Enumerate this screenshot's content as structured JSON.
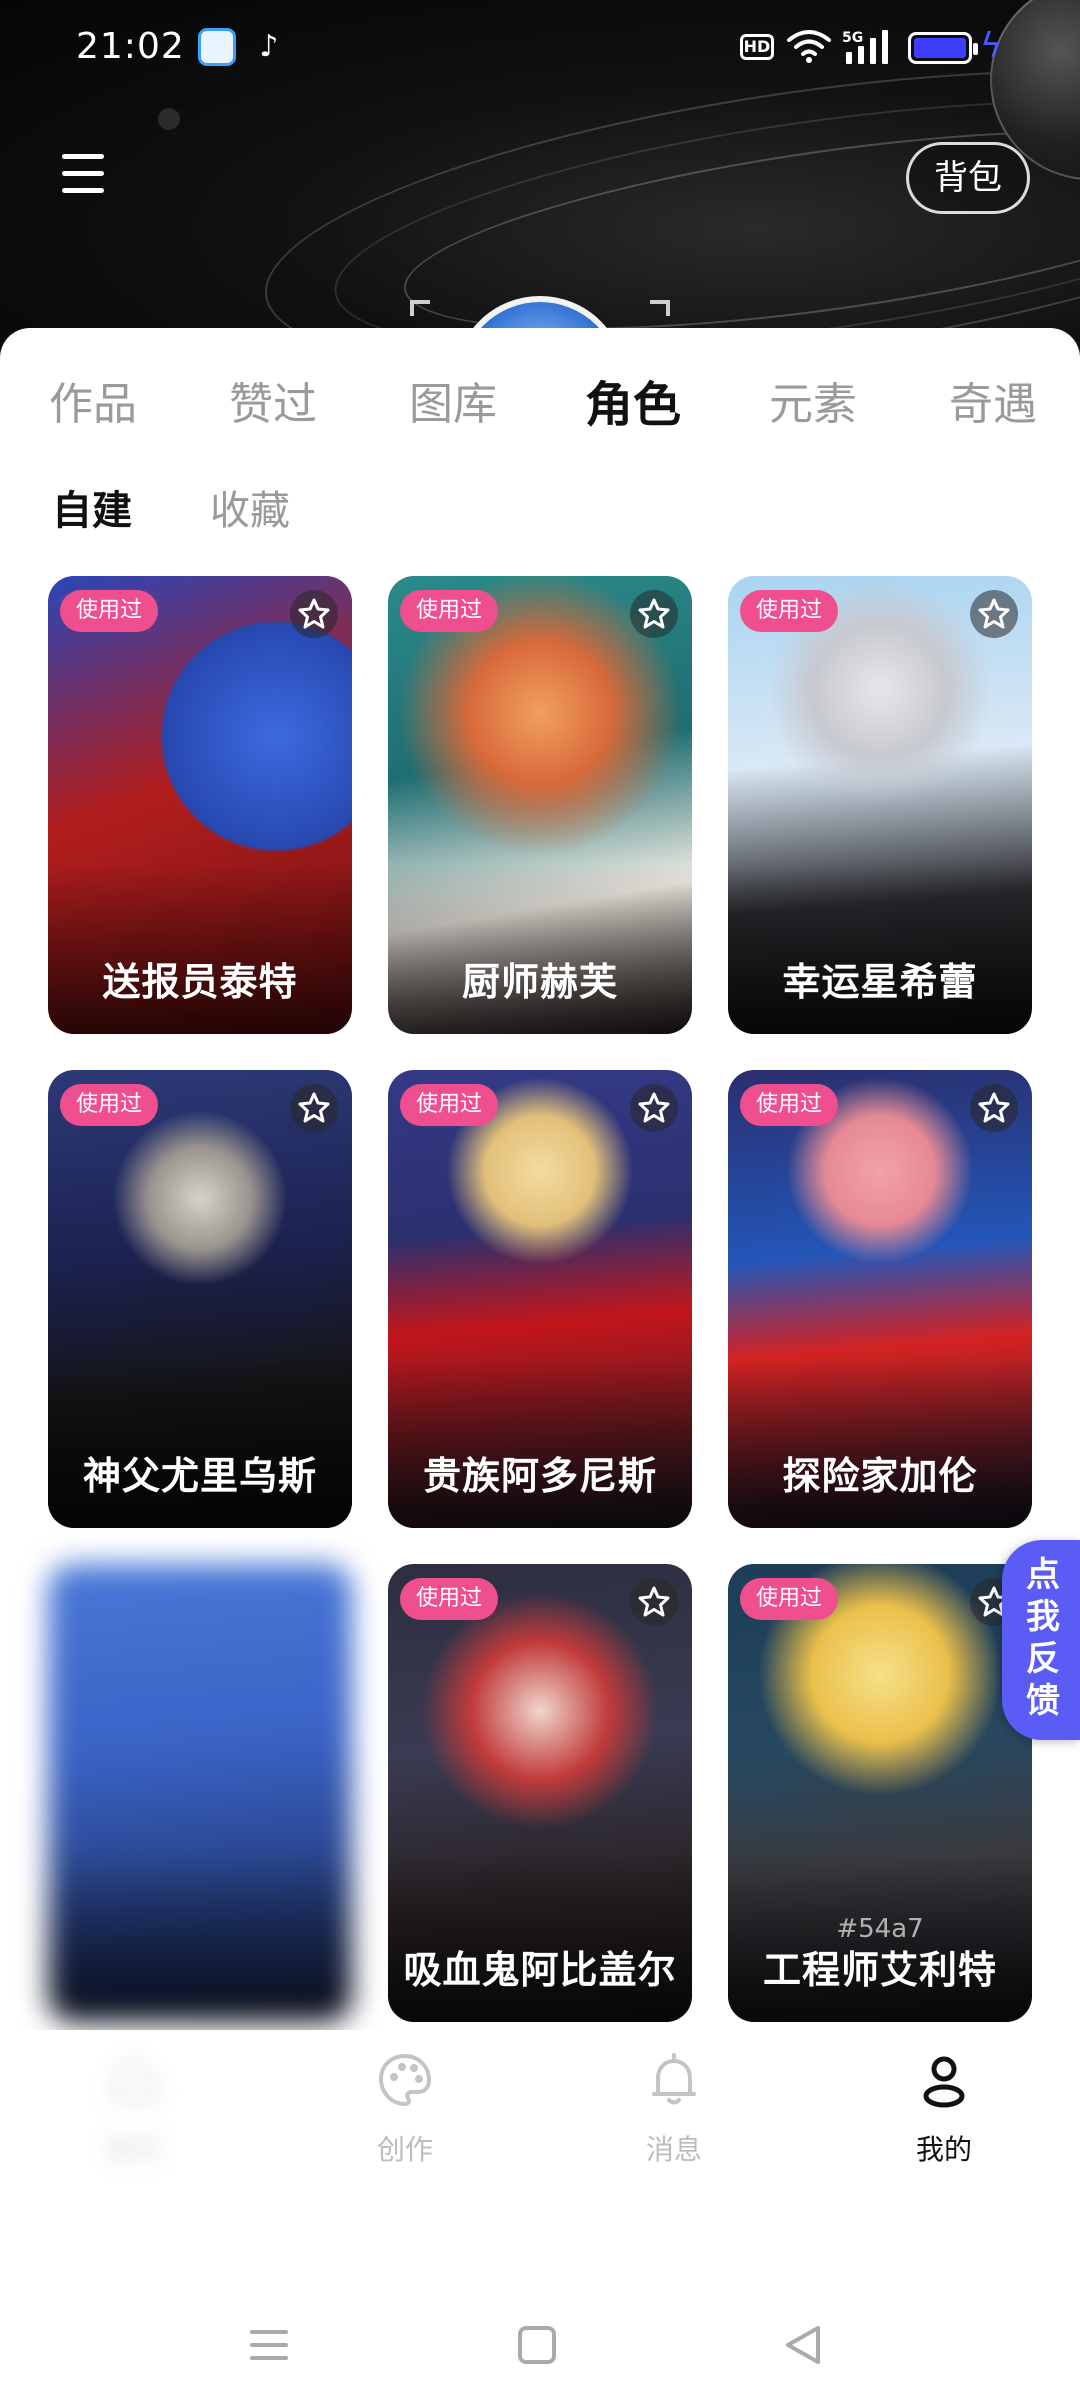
{
  "status_bar": {
    "time": "21:02",
    "hd_label": "HD",
    "network": "5G",
    "battery_color": "#3d3dff"
  },
  "header": {
    "bag_label": "背包"
  },
  "tabs": [
    {
      "label": "作品",
      "active": false
    },
    {
      "label": "赞过",
      "active": false
    },
    {
      "label": "图库",
      "active": false
    },
    {
      "label": "角色",
      "active": true
    },
    {
      "label": "元素",
      "active": false
    },
    {
      "label": "奇遇",
      "active": false
    }
  ],
  "subtabs": [
    {
      "label": "自建",
      "active": true
    },
    {
      "label": "收藏",
      "active": false
    }
  ],
  "cards": [
    {
      "name": "送报员泰特",
      "badge": "使用过",
      "tag": ""
    },
    {
      "name": "厨师赫芙",
      "badge": "使用过",
      "tag": ""
    },
    {
      "name": "幸运星希蕾",
      "badge": "使用过",
      "tag": ""
    },
    {
      "name": "神父尤里乌斯",
      "badge": "使用过",
      "tag": ""
    },
    {
      "name": "贵族阿多尼斯",
      "badge": "使用过",
      "tag": ""
    },
    {
      "name": "探险家加伦",
      "badge": "使用过",
      "tag": ""
    },
    {
      "name": "",
      "badge": "",
      "tag": ""
    },
    {
      "name": "吸血鬼阿比盖尔",
      "badge": "使用过",
      "tag": ""
    },
    {
      "name": "工程师艾利特",
      "badge": "使用过",
      "tag": "#54a7"
    }
  ],
  "feedback": {
    "label": "点我反馈"
  },
  "bottom_nav": [
    {
      "label": "首页",
      "icon": "home-icon",
      "active": false
    },
    {
      "label": "创作",
      "icon": "palette-icon",
      "active": false
    },
    {
      "label": "消息",
      "icon": "bell-icon",
      "active": false
    },
    {
      "label": "我的",
      "icon": "user-icon",
      "active": true
    }
  ],
  "colors": {
    "accent": "#5b5bf5",
    "badge": "#ef4f8e",
    "tab_active": "#111111",
    "tab_inactive": "#9a9a9a"
  }
}
